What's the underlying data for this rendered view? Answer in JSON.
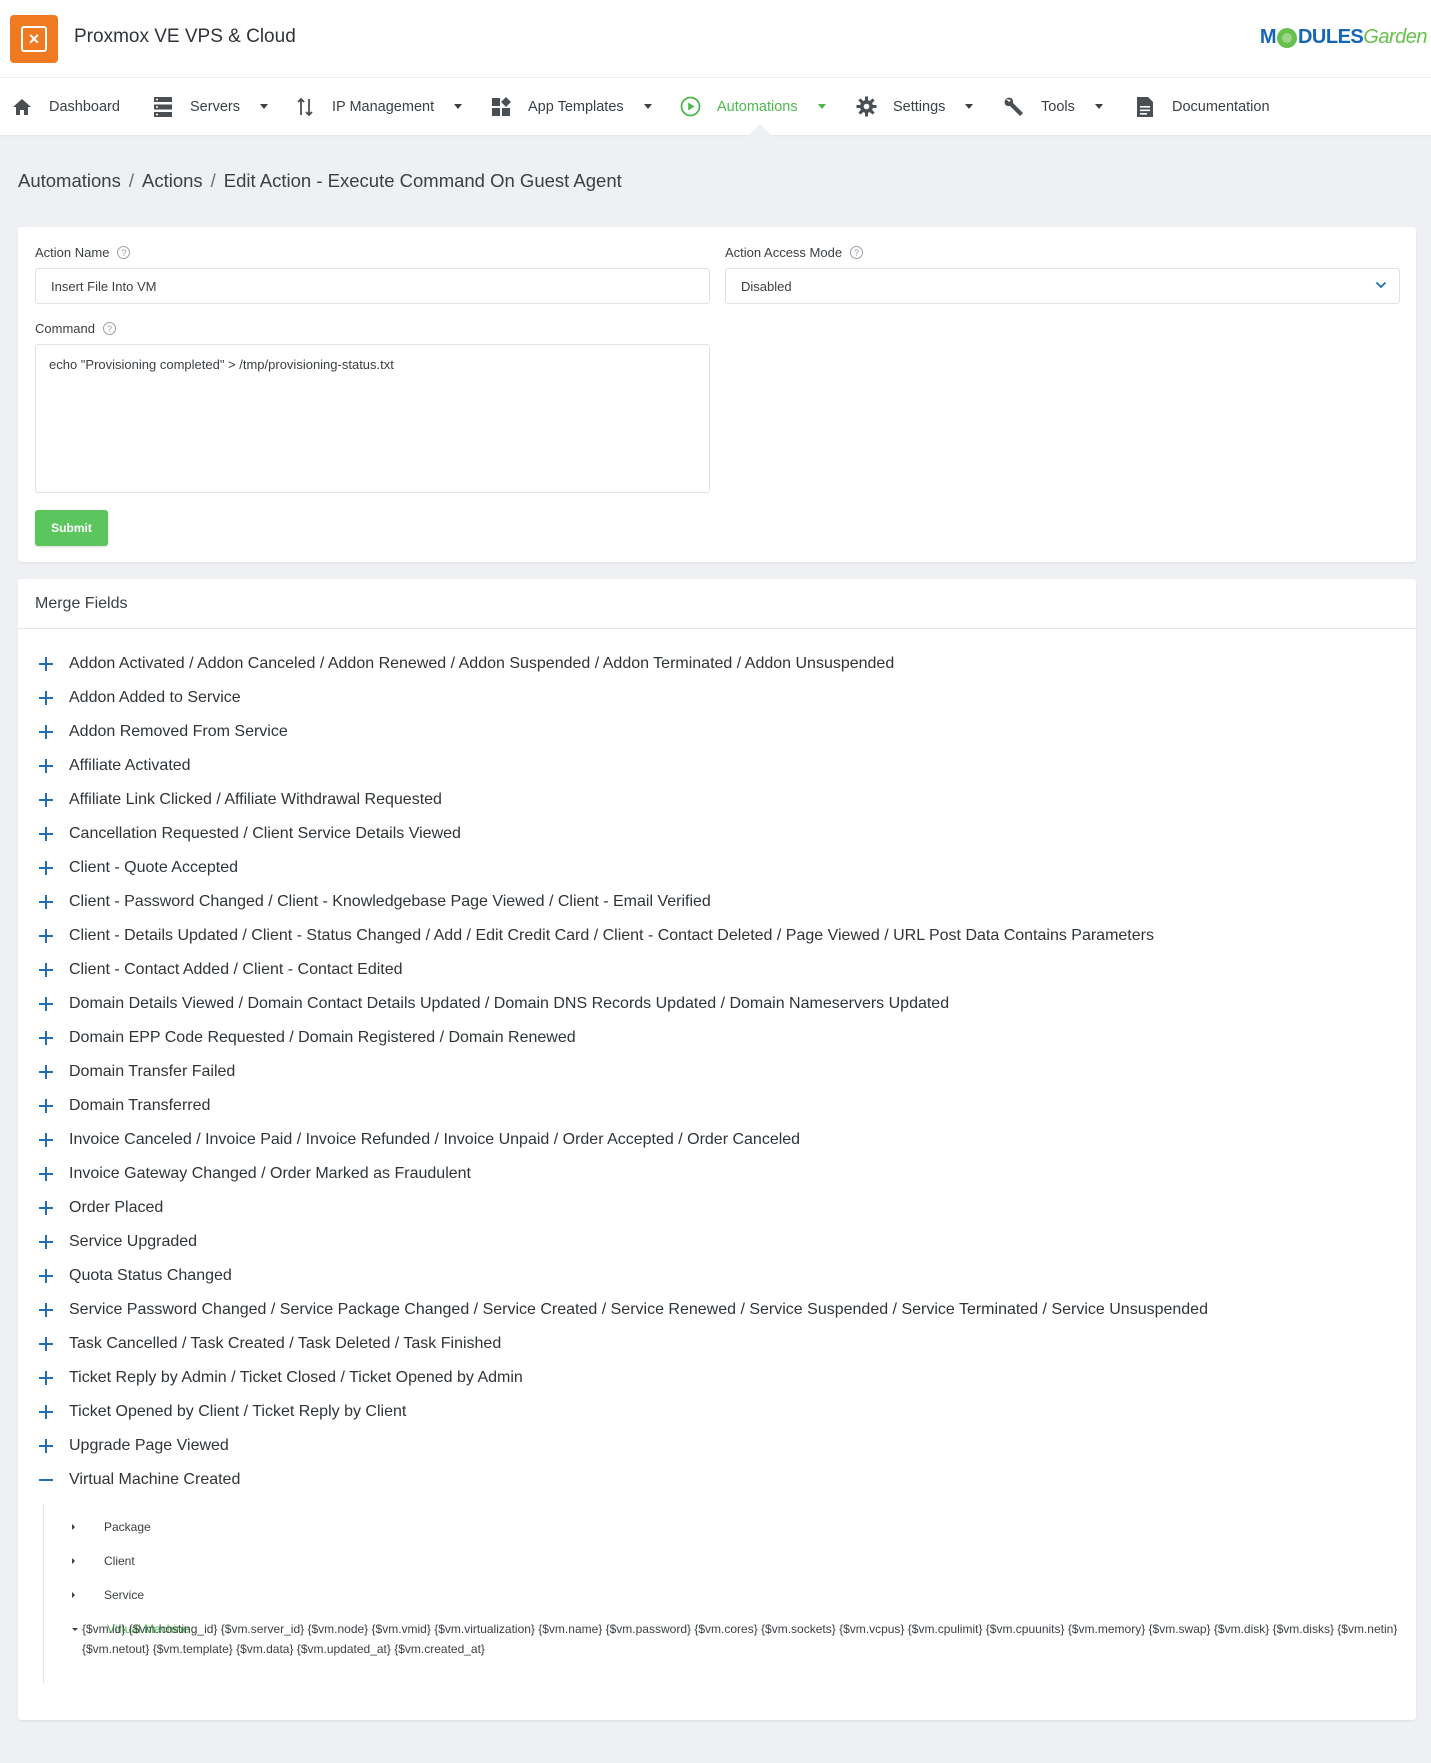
{
  "header": {
    "app_title": "Proxmox VE VPS & Cloud",
    "brand_parts": [
      "M",
      "DULES",
      "Garden"
    ]
  },
  "nav": {
    "items": [
      {
        "label": "Dashboard",
        "icon": "home-icon",
        "has_caret": false
      },
      {
        "label": "Servers",
        "icon": "servers-icon",
        "has_caret": true
      },
      {
        "label": "IP Management",
        "icon": "ip-management-icon",
        "has_caret": true
      },
      {
        "label": "App Templates",
        "icon": "app-templates-icon",
        "has_caret": true
      },
      {
        "label": "Automations",
        "icon": "play-circle-icon",
        "has_caret": true,
        "active": true
      },
      {
        "label": "Settings",
        "icon": "gear-icon",
        "has_caret": true
      },
      {
        "label": "Tools",
        "icon": "wrench-icon",
        "has_caret": true
      },
      {
        "label": "Documentation",
        "icon": "document-icon",
        "has_caret": false
      }
    ]
  },
  "breadcrumb": {
    "items": [
      "Automations",
      "Actions",
      "Edit Action - Execute Command On Guest Agent"
    ],
    "separator": "/"
  },
  "form": {
    "action_name_label": "Action Name",
    "action_name_value": "Insert File Into VM",
    "access_mode_label": "Action Access Mode",
    "access_mode_value": "Disabled",
    "command_label": "Command",
    "command_value": "echo \"Provisioning completed\" > /tmp/provisioning-status.txt",
    "submit_label": "Submit"
  },
  "merge_fields": {
    "title": "Merge Fields",
    "groups": [
      {
        "label": "Addon Activated / Addon Canceled / Addon Renewed / Addon Suspended / Addon Terminated / Addon Unsuspended",
        "expanded": false
      },
      {
        "label": "Addon Added to Service",
        "expanded": false
      },
      {
        "label": "Addon Removed From Service",
        "expanded": false
      },
      {
        "label": "Affiliate Activated",
        "expanded": false
      },
      {
        "label": "Affiliate Link Clicked / Affiliate Withdrawal Requested",
        "expanded": false
      },
      {
        "label": "Cancellation Requested / Client Service Details Viewed",
        "expanded": false
      },
      {
        "label": "Client - Quote Accepted",
        "expanded": false
      },
      {
        "label": "Client - Password Changed / Client - Knowledgebase Page Viewed / Client - Email Verified",
        "expanded": false
      },
      {
        "label": "Client - Details Updated / Client - Status Changed / Add / Edit Credit Card / Client - Contact Deleted / Page Viewed / URL Post Data Contains Parameters",
        "expanded": false
      },
      {
        "label": "Client - Contact Added / Client - Contact Edited",
        "expanded": false
      },
      {
        "label": "Domain Details Viewed / Domain Contact Details Updated / Domain DNS Records Updated / Domain Nameservers Updated",
        "expanded": false
      },
      {
        "label": "Domain EPP Code Requested / Domain Registered / Domain Renewed",
        "expanded": false
      },
      {
        "label": "Domain Transfer Failed",
        "expanded": false
      },
      {
        "label": "Domain Transferred",
        "expanded": false
      },
      {
        "label": "Invoice Canceled / Invoice Paid / Invoice Refunded / Invoice Unpaid / Order Accepted / Order Canceled",
        "expanded": false
      },
      {
        "label": "Invoice Gateway Changed / Order Marked as Fraudulent",
        "expanded": false
      },
      {
        "label": "Order Placed",
        "expanded": false
      },
      {
        "label": "Service Upgraded",
        "expanded": false
      },
      {
        "label": "Quota Status Changed",
        "expanded": false
      },
      {
        "label": "Service Password Changed / Service Package Changed / Service Created / Service Renewed / Service Suspended / Service Terminated / Service Unsuspended",
        "expanded": false
      },
      {
        "label": "Task Cancelled / Task Created / Task Deleted / Task Finished",
        "expanded": false
      },
      {
        "label": "Ticket Reply by Admin / Ticket Closed / Ticket Opened by Admin",
        "expanded": false
      },
      {
        "label": "Ticket Opened by Client / Ticket Reply by Client",
        "expanded": false
      },
      {
        "label": "Upgrade Page Viewed",
        "expanded": false
      },
      {
        "label": "Virtual Machine Created",
        "expanded": true
      }
    ],
    "tree": [
      {
        "label": "Package",
        "open": false
      },
      {
        "label": "Client",
        "open": false
      },
      {
        "label": "Service",
        "open": false
      },
      {
        "label": "Virtual Machine",
        "open": true
      }
    ],
    "vm_variables": "{$vm.id} {$vm.hosting_id} {$vm.server_id} {$vm.node} {$vm.vmid} {$vm.virtualization} {$vm.name} {$vm.password} {$vm.cores} {$vm.sockets} {$vm.vcpus} {$vm.cpulimit} {$vm.cpuunits} {$vm.memory} {$vm.swap} {$vm.disk} {$vm.disks} {$vm.netin} {$vm.netout} {$vm.template} {$vm.data} {$vm.updated_at} {$vm.created_at}"
  },
  "colors": {
    "accent_green": "#4cb84c",
    "submit_green": "#5cc65e",
    "logo_orange": "#f07a22",
    "plus_blue": "#1f6fb5",
    "brand_blue": "#1566b8"
  }
}
